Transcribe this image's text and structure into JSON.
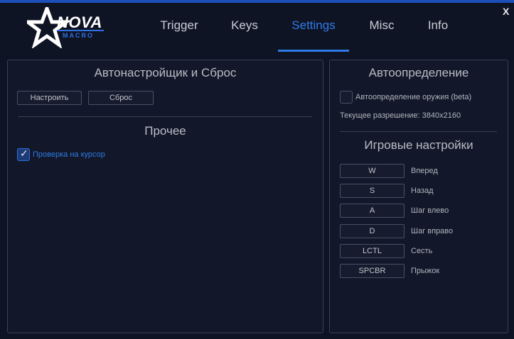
{
  "logo": {
    "main": "NOVA",
    "sub": "MACRO"
  },
  "nav": {
    "tabs": [
      {
        "label": "Trigger",
        "active": false
      },
      {
        "label": "Keys",
        "active": false
      },
      {
        "label": "Settings",
        "active": true
      },
      {
        "label": "Misc",
        "active": false
      },
      {
        "label": "Info",
        "active": false
      }
    ]
  },
  "window": {
    "close_label": "X"
  },
  "left_panel": {
    "autoconfig_title": "Автонастройщик и Сброс",
    "configure_button": "Настроить",
    "reset_button": "Сброс",
    "other_title": "Прочее",
    "cursor_check": {
      "label": "Проверка на курсор",
      "checked": true
    }
  },
  "right_panel": {
    "autodetect_title": "Автоопределение",
    "weapon_autodetect": {
      "label": "Автоопределение оружия (beta)",
      "checked": false
    },
    "resolution_text": "Текущее разрешение: 3840x2160",
    "game_settings_title": "Игровые настройки",
    "keybinds": [
      {
        "key": "W",
        "action": "Вперед"
      },
      {
        "key": "S",
        "action": "Назад"
      },
      {
        "key": "A",
        "action": "Шаг влево"
      },
      {
        "key": "D",
        "action": "Шаг вправо"
      },
      {
        "key": "LCTL",
        "action": "Сесть"
      },
      {
        "key": "SPCBR",
        "action": "Прыжок"
      }
    ]
  },
  "colors": {
    "accent": "#2e7be6",
    "background": "#0f1424",
    "panel_border": "#3a4052"
  }
}
